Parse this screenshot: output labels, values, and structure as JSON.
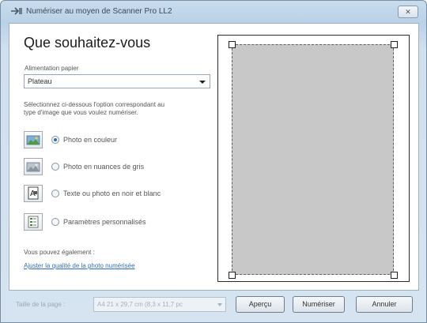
{
  "window": {
    "title": "Numériser au moyen de Scanner Pro LL2",
    "close_label": "✕"
  },
  "main": {
    "heading": "Que souhaitez-vous",
    "paper_feed_label": "Alimentation papier",
    "paper_feed_value": "Plateau",
    "instructions_line1": "Sélectionnez ci-dessous l'option correspondant au",
    "instructions_line2": "type d'image que vous voulez numériser.",
    "options": [
      {
        "label": "Photo en couleur",
        "selected": true,
        "icon": "color-photo-icon"
      },
      {
        "label": "Photo en nuances de gris",
        "selected": false,
        "icon": "grayscale-photo-icon"
      },
      {
        "label": "Texte ou photo en noir et blanc",
        "selected": false,
        "icon": "black-white-text-icon"
      },
      {
        "label": "Paramètres personnalisés",
        "selected": false,
        "icon": "custom-settings-icon"
      }
    ],
    "also_label": "Vous pouvez également :",
    "adjust_link": "Ajuster la qualité de la photo numérisée"
  },
  "footer": {
    "page_size_label": "Taille de la page :",
    "page_size_value": "A4 21 x 29,7 cm (8,3 x 11,7 pc",
    "preview_button": "Aperçu",
    "scan_button": "Numériser",
    "cancel_button": "Annuler"
  },
  "colors": {
    "accent": "#2f6bb7",
    "link": "#2f6fb9",
    "scan_area": "#c8c8c8"
  }
}
